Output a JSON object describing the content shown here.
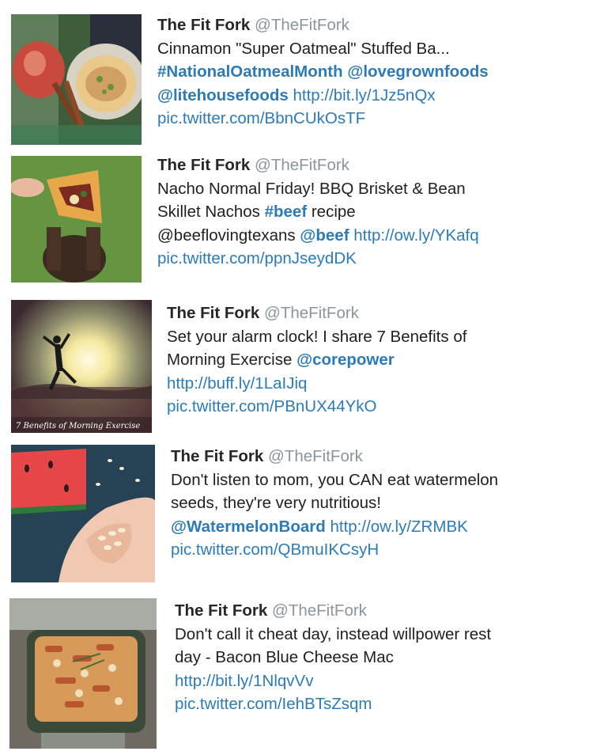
{
  "tweets": [
    {
      "author": "The Fit Fork",
      "handle": "@TheFitFork",
      "line1": "Cinnamon \"Super Oatmeal\" Stuffed Ba...",
      "hashtag": "#NationalOatmealMonth",
      "mention1": "@lovegrownfoods",
      "mention2": "@litehousefoods",
      "url": "http://bit.ly/1Jz5nQx",
      "pic": "pic.twitter.com/BbnCUkOsTF"
    },
    {
      "author": "The Fit Fork",
      "handle": "@TheFitFork",
      "line1": "Nacho Normal Friday! BBQ Brisket & Bean",
      "line2_text": "Skillet Nachos",
      "hashtag": "#beef",
      "line2_tail": "recipe",
      "plain_mention": "@beeflovingtexans",
      "mention": "@beef",
      "url": "http://ow.ly/YKafq",
      "pic": "pic.twitter.com/ppnJseydDK"
    },
    {
      "author": "The Fit Fork",
      "handle": "@TheFitFork",
      "line1": "Set your alarm clock! I share 7 Benefits of",
      "line2_text": "Morning Exercise",
      "mention": "@corepower",
      "url": "http://buff.ly/1LaIJiq",
      "pic": "pic.twitter.com/PBnUX44YkO",
      "image_caption": "7 Benefits of Morning Exercise"
    },
    {
      "author": "The Fit Fork",
      "handle": "@TheFitFork",
      "line1": "Don't listen to mom, you CAN eat watermelon",
      "line2": "seeds, they're very nutritious!",
      "mention": "@WatermelonBoard",
      "url": "http://ow.ly/ZRMBK",
      "pic": "pic.twitter.com/QBmuIKCsyH"
    },
    {
      "author": "The Fit Fork",
      "handle": "@TheFitFork",
      "line1": "Don't call it cheat day, instead willpower rest",
      "line2": "day - Bacon Blue Cheese Mac",
      "url": "http://bit.ly/1NlqvVv",
      "pic": "pic.twitter.com/IehBTsZsqm"
    }
  ],
  "colors": {
    "link": "#2b7bb9",
    "handle": "#8a959e",
    "text": "#1f1f1f"
  }
}
